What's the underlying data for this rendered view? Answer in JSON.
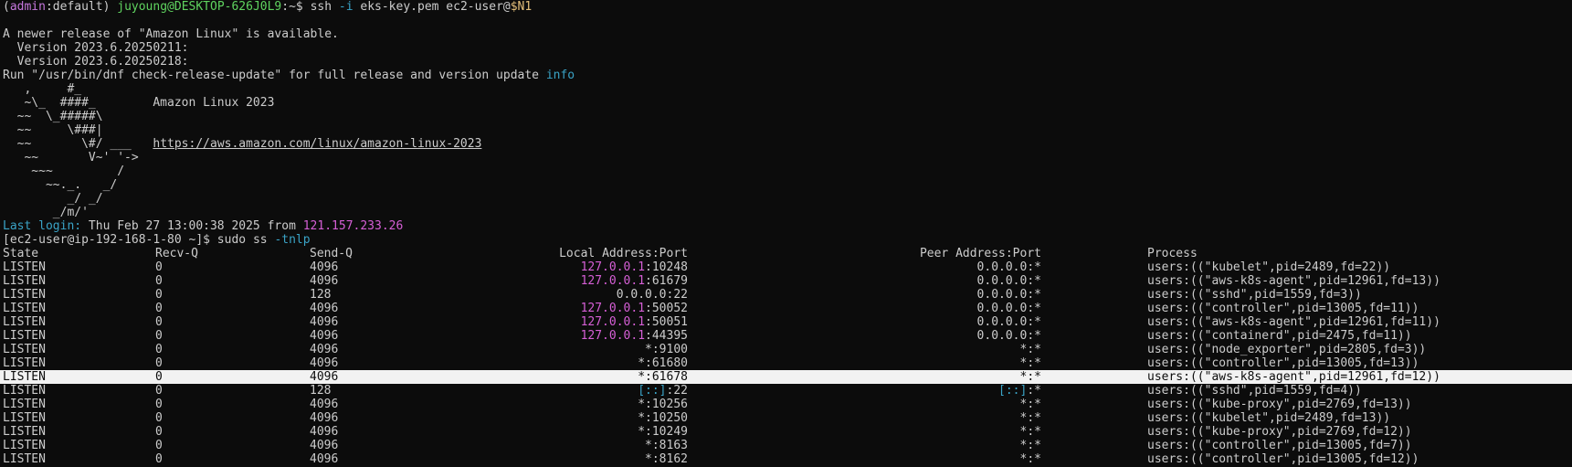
{
  "prompt1": {
    "open_paren": "(",
    "ctx_admin": "admin",
    "ctx_rest": ":default)",
    "userhost": "juyoung@DESKTOP-626J0L9",
    "path": ":~$",
    "cmd": " ssh ",
    "flag": "-i",
    "args": " eks-key.pem ec2-user@",
    "var": "$N1"
  },
  "motd": {
    "line1": "A newer release of \"Amazon Linux\" is available.",
    "line2": "  Version 2023.6.20250211:",
    "line3": "  Version 2023.6.20250218:",
    "line4_prefix": "Run \"/usr/bin/dnf check-release-update\" for full release and version update ",
    "line4_info": "info"
  },
  "banner": {
    "art": [
      "   ,     #_",
      "   ~\\_  ####_        Amazon Linux 2023",
      "  ~~  \\_#####\\",
      "  ~~     \\###|",
      "  ~~       \\#/ ___   ",
      "   ~~       V~' '->",
      "    ~~~         /",
      "      ~~._.   _/",
      "         _/ _/",
      "       _/m/'"
    ],
    "url": "https://aws.amazon.com/linux/amazon-linux-2023"
  },
  "last_login": {
    "label": "Last login:",
    "text": " Thu Feb 27 13:00:38 2025 from ",
    "ip": "121.157.233.26"
  },
  "prompt2": {
    "ps1": "[ec2-user@ip-192-168-1-80 ~]$",
    "cmd": " sudo ss ",
    "flag": "-tnlp"
  },
  "ss": {
    "headers": {
      "state": "State",
      "recv": "Recv-Q",
      "send": "Send-Q",
      "local": "Local Address:Port",
      "peer": "Peer Address:Port",
      "process": "Process"
    },
    "rows": [
      {
        "state": "LISTEN",
        "recv": "0",
        "send": "4096",
        "local_ip": "127.0.0.1",
        "local_port": ":10248",
        "peer_ip": "0.0.0.0",
        "peer_port": ":*",
        "process": "users:((\"kubelet\",pid=2489,fd=22))"
      },
      {
        "state": "LISTEN",
        "recv": "0",
        "send": "4096",
        "local_ip": "127.0.0.1",
        "local_port": ":61679",
        "peer_ip": "0.0.0.0",
        "peer_port": ":*",
        "process": "users:((\"aws-k8s-agent\",pid=12961,fd=13))"
      },
      {
        "state": "LISTEN",
        "recv": "0",
        "send": "128",
        "local_ip": "0.0.0.0",
        "local_port": ":22",
        "peer_ip": "0.0.0.0",
        "peer_port": ":*",
        "process": "users:((\"sshd\",pid=1559,fd=3))"
      },
      {
        "state": "LISTEN",
        "recv": "0",
        "send": "4096",
        "local_ip": "127.0.0.1",
        "local_port": ":50052",
        "peer_ip": "0.0.0.0",
        "peer_port": ":*",
        "process": "users:((\"controller\",pid=13005,fd=11))"
      },
      {
        "state": "LISTEN",
        "recv": "0",
        "send": "4096",
        "local_ip": "127.0.0.1",
        "local_port": ":50051",
        "peer_ip": "0.0.0.0",
        "peer_port": ":*",
        "process": "users:((\"aws-k8s-agent\",pid=12961,fd=11))"
      },
      {
        "state": "LISTEN",
        "recv": "0",
        "send": "4096",
        "local_ip": "127.0.0.1",
        "local_port": ":44395",
        "peer_ip": "0.0.0.0",
        "peer_port": ":*",
        "process": "users:((\"containerd\",pid=2475,fd=11))"
      },
      {
        "state": "LISTEN",
        "recv": "0",
        "send": "4096",
        "local_ip": "*",
        "local_port": ":9100",
        "peer_ip": "*",
        "peer_port": ":*",
        "process": "users:((\"node_exporter\",pid=2805,fd=3))"
      },
      {
        "state": "LISTEN",
        "recv": "0",
        "send": "4096",
        "local_ip": "*",
        "local_port": ":61680",
        "peer_ip": "*",
        "peer_port": ":*",
        "process": "users:((\"controller\",pid=13005,fd=13))"
      },
      {
        "state": "LISTEN",
        "recv": "0",
        "send": "4096",
        "local_ip": "*",
        "local_port": ":61678",
        "peer_ip": "*",
        "peer_port": ":*",
        "process": "users:((\"aws-k8s-agent\",pid=12961,fd=12))",
        "selected": true
      },
      {
        "state": "LISTEN",
        "recv": "0",
        "send": "128",
        "local_ip": "[::]",
        "local_port": ":22",
        "peer_ip": "[::]",
        "peer_port": ":*",
        "process": "users:((\"sshd\",pid=1559,fd=4))"
      },
      {
        "state": "LISTEN",
        "recv": "0",
        "send": "4096",
        "local_ip": "*",
        "local_port": ":10256",
        "peer_ip": "*",
        "peer_port": ":*",
        "process": "users:((\"kube-proxy\",pid=2769,fd=13))"
      },
      {
        "state": "LISTEN",
        "recv": "0",
        "send": "4096",
        "local_ip": "*",
        "local_port": ":10250",
        "peer_ip": "*",
        "peer_port": ":*",
        "process": "users:((\"kubelet\",pid=2489,fd=13))"
      },
      {
        "state": "LISTEN",
        "recv": "0",
        "send": "4096",
        "local_ip": "*",
        "local_port": ":10249",
        "peer_ip": "*",
        "peer_port": ":*",
        "process": "users:((\"kube-proxy\",pid=2769,fd=12))"
      },
      {
        "state": "LISTEN",
        "recv": "0",
        "send": "4096",
        "local_ip": "*",
        "local_port": ":8163",
        "peer_ip": "*",
        "peer_port": ":*",
        "process": "users:((\"controller\",pid=13005,fd=7))"
      },
      {
        "state": "LISTEN",
        "recv": "0",
        "send": "4096",
        "local_ip": "*",
        "local_port": ":8162",
        "peer_ip": "*",
        "peer_port": ":*",
        "process": "users:((\"controller\",pid=13005,fd=12))"
      }
    ]
  },
  "colors": {
    "background": "#0c0c0c",
    "foreground": "#cccccc",
    "prompt_user": "#5fd35f",
    "ctx_admin": "#c678dd",
    "variable": "#e5c07b",
    "flag": "#3aa3c6",
    "localhost_ip": "#d65fd6",
    "selection_bg": "#f2f2f2"
  }
}
